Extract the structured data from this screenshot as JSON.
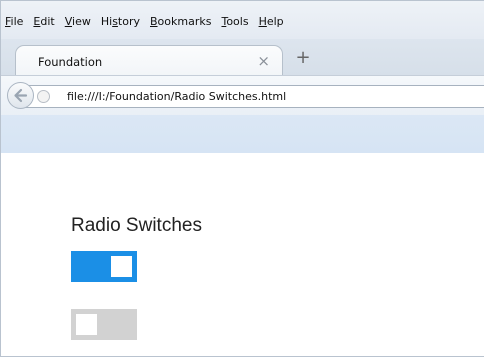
{
  "menubar": {
    "items": [
      {
        "accel": "F",
        "rest": "ile"
      },
      {
        "accel": "E",
        "rest": "dit"
      },
      {
        "accel": "V",
        "rest": "iew"
      },
      {
        "pre": "Hi",
        "accel": "s",
        "rest": "tory"
      },
      {
        "accel": "B",
        "rest": "ookmarks"
      },
      {
        "accel": "T",
        "rest": "ools"
      },
      {
        "accel": "H",
        "rest": "elp"
      }
    ]
  },
  "tab": {
    "title": "Foundation",
    "close_glyph": "×",
    "new_tab_glyph": "+"
  },
  "navbar": {
    "url": "file:///I:/Foundation/Radio Switches.html"
  },
  "page": {
    "heading": "Radio Switches",
    "switches": [
      {
        "state": "on",
        "color": "#1b8fe6"
      },
      {
        "state": "off",
        "color": "#d2d2d2"
      }
    ]
  }
}
